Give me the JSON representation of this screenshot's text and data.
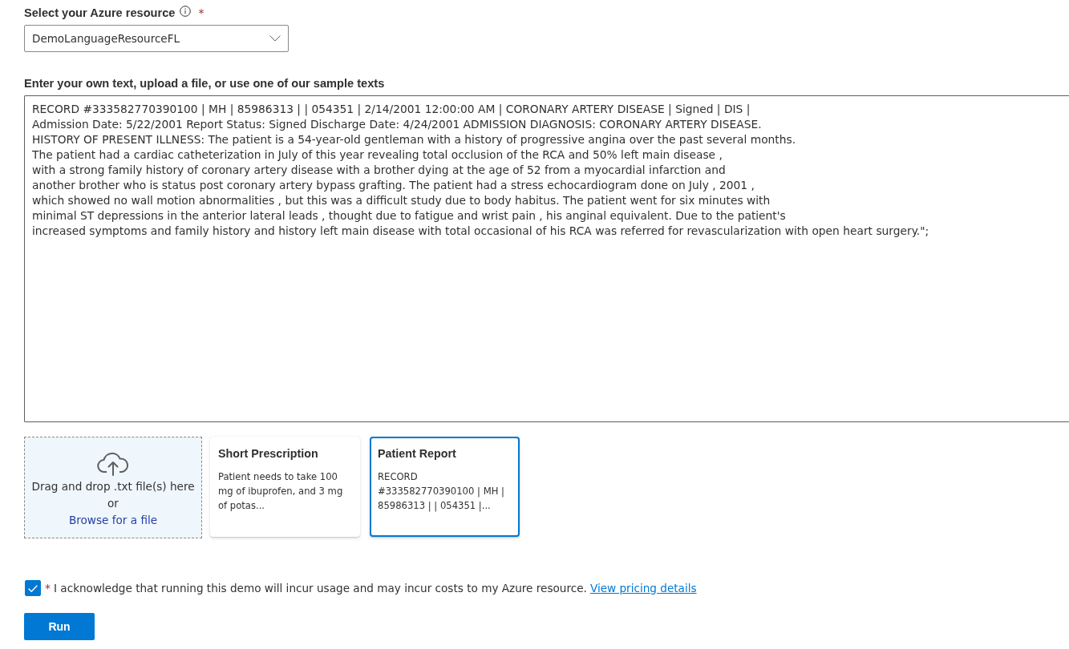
{
  "resource": {
    "label": "Select your Azure resource",
    "required_mark": "*",
    "value": "DemoLanguageResourceFL"
  },
  "text_input": {
    "label": "Enter your own text, upload a file, or use one of our sample texts",
    "value": "RECORD #333582770390100 | MH | 85986313 | | 054351 | 2/14/2001 12:00:00 AM | CORONARY ARTERY DISEASE | Signed | DIS |\nAdmission Date: 5/22/2001 Report Status: Signed Discharge Date: 4/24/2001 ADMISSION DIAGNOSIS: CORONARY ARTERY DISEASE.\nHISTORY OF PRESENT ILLNESS: The patient is a 54-year-old gentleman with a history of progressive angina over the past several months.\nThe patient had a cardiac catheterization in July of this year revealing total occlusion of the RCA and 50% left main disease ,\nwith a strong family history of coronary artery disease with a brother dying at the age of 52 from a myocardial infarction and\nanother brother who is status post coronary artery bypass grafting. The patient had a stress echocardiogram done on July , 2001 ,\nwhich showed no wall motion abnormalities , but this was a difficult study due to body habitus. The patient went for six minutes with\nminimal ST depressions in the anterior lateral leads , thought due to fatigue and wrist pain , his anginal equivalent. Due to the patient's\nincreased symptoms and family history and history left main disease with total occasional of his RCA was referred for revascularization with open heart surgery.\";"
  },
  "upload": {
    "line_1": "Drag and drop .txt file(s) here",
    "line_2": "or",
    "link": "Browse for a file"
  },
  "samples": [
    {
      "title": "Short Prescription",
      "preview": "Patient needs to take 100 mg of ibuprofen, and 3 mg of potas...",
      "selected": false
    },
    {
      "title": "Patient Report",
      "preview": "RECORD #333582770390100 | MH | 85986313 | | 054351 |...",
      "selected": true
    }
  ],
  "acknowledgement": {
    "checked": true,
    "required_mark": "*",
    "text": "I acknowledge that running this demo will incur usage and may incur costs to my Azure resource.",
    "link": "View pricing details"
  },
  "buttons": [
    "Run"
  ]
}
